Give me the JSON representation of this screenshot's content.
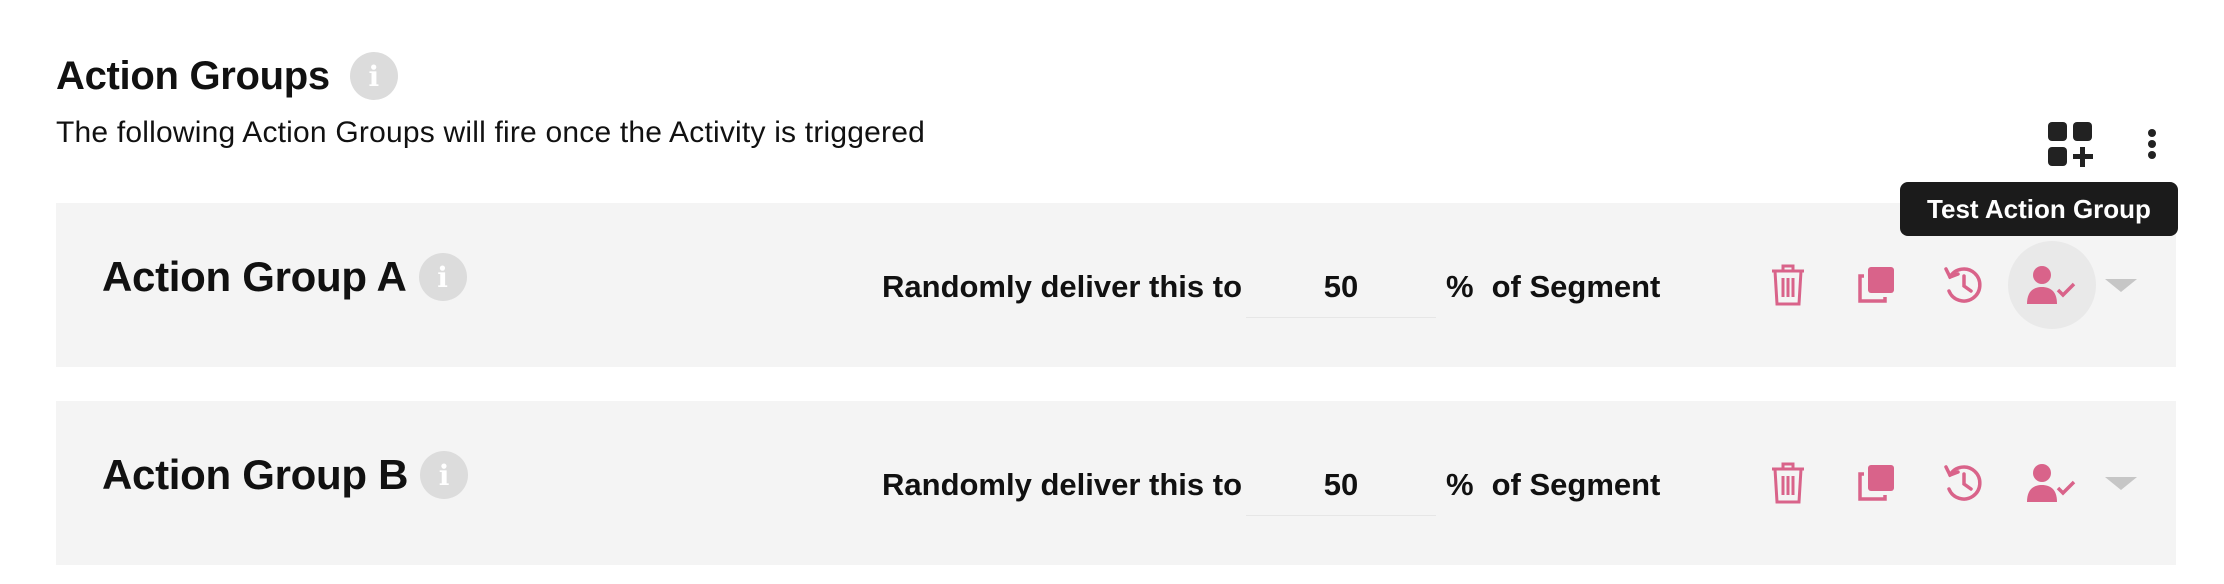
{
  "header": {
    "title": "Action Groups",
    "info_icon": "info-icon",
    "subtitle": "The following Action Groups will fire once the Activity is triggered"
  },
  "toolbar": {
    "add_group_icon": "add-widget-icon",
    "more_icon": "more-vertical-icon"
  },
  "tooltip": {
    "text": "Test Action Group"
  },
  "colors": {
    "accent_pink": "#d9638a",
    "card_bg": "#f4f4f4",
    "info_badge": "#dcdcdc",
    "tooltip_bg": "#1b1b1b"
  },
  "groups": [
    {
      "name": "Action Group A",
      "deliver_prefix": "Randomly deliver this to",
      "percent": "50",
      "percent_sign": "%",
      "deliver_suffix": "of Segment",
      "actions": [
        "trash-icon",
        "copy-icon",
        "history-icon",
        "test-user-icon",
        "chevron-down-icon"
      ]
    },
    {
      "name": "Action Group B",
      "deliver_prefix": "Randomly deliver this to",
      "percent": "50",
      "percent_sign": "%",
      "deliver_suffix": "of Segment",
      "actions": [
        "trash-icon",
        "copy-icon",
        "history-icon",
        "test-user-icon",
        "chevron-down-icon"
      ]
    }
  ]
}
